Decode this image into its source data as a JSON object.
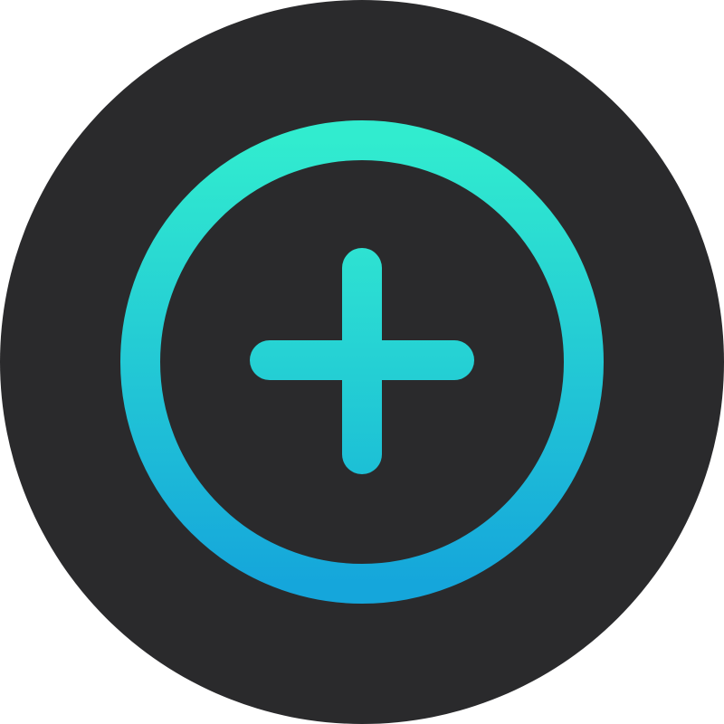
{
  "app_icon": {
    "name": "add-button",
    "icon": "plus-circle-icon",
    "background_color": "#2a2a2c",
    "accent_gradient_top": "#31eccf",
    "accent_gradient_bottom": "#15a6db"
  }
}
